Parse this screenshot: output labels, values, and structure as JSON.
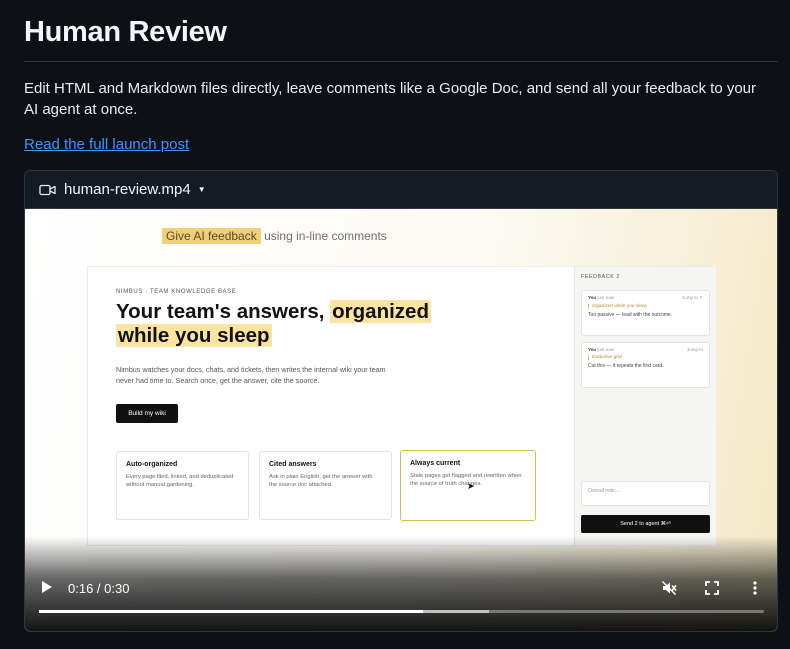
{
  "page": {
    "title": "Human Review",
    "description": "Edit HTML and Markdown files directly, leave comments like a Google Doc, and send all your feedback to your AI agent at once.",
    "link_text": "Read the full launch post"
  },
  "video": {
    "filename": "human-review.mp4",
    "icons": [
      "video-camera-icon",
      "caret-down-icon",
      "play-icon",
      "mute-icon",
      "fullscreen-icon",
      "more-icon"
    ],
    "time_display": "0:16 / 0:30",
    "progress": {
      "played_fraction": 0.53,
      "buffered_fraction": 0.62
    },
    "frame": {
      "caption_highlight": "Give AI feedback",
      "caption_rest": "using in-line comments",
      "eyebrow": "NIMBUS · TEAM KNOWLEDGE BASE",
      "hero_plain": "Your team's answers,",
      "hero_highlight_1": "organized",
      "hero_highlight_2": "while you sleep",
      "lead": "Nimbus watches your docs, chats, and tickets, then writes the internal wiki your team never had time to. Search once, get the answer, cite the source.",
      "cta": "Build my wiki",
      "cards": [
        {
          "title": "Auto-organized",
          "body": "Every page filed, linked, and deduplicated without manual gardening."
        },
        {
          "title": "Cited answers",
          "body": "Ask in plain English, get the answer with the source doc attached."
        },
        {
          "title": "Always current",
          "body": "Stale pages get flagged and rewritten when the source of truth changes."
        }
      ],
      "feedback": {
        "heading": "FEEDBACK 2",
        "items": [
          {
            "author": "You",
            "time": "just now",
            "action": "Jump to ✕",
            "quote": "organized while you sleep",
            "text": "Too passive — lead with the outcome."
          },
          {
            "author": "You",
            "time": "just now",
            "action": "Jump to",
            "quote": "Exclusive grid",
            "text": "Cut this — it repeats the first card."
          }
        ],
        "note_placeholder": "Overall note...",
        "send_label": "Send 2 to agent ⌘⏎"
      }
    }
  },
  "colors": {
    "background": "#0d1117",
    "link": "#4493f8",
    "highlight": "#f0cf7a"
  }
}
